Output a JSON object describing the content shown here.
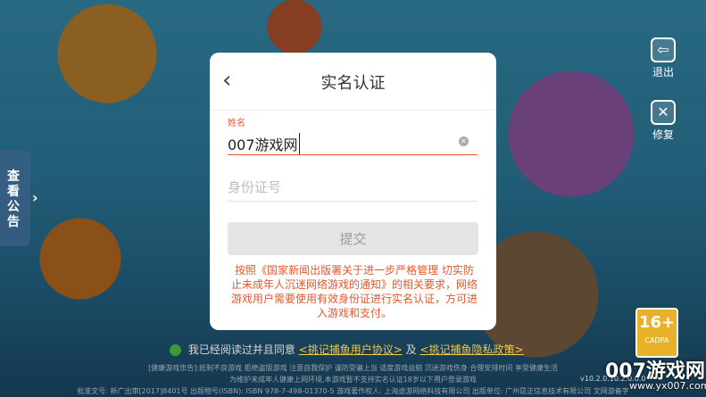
{
  "dialog": {
    "title": "实名认证",
    "name_label": "姓名",
    "name_value": "007游戏网",
    "id_placeholder": "身份证号",
    "submit_label": "提交",
    "notice": "按照《国家新闻出版署关于进一步严格管理 切实防止未成年人沉迷网络游戏的通知》的相关要求，网络游戏用户需要使用有效身份证进行实名认证，方可进入游戏和支付。"
  },
  "side_buttons": {
    "exit": "退出",
    "repair": "修复"
  },
  "notice_tab": "查看公告",
  "rating": {
    "age": "16+",
    "label": "CADPA"
  },
  "agreement": {
    "prefix": "我已经阅读过并且同意",
    "link1": "<挑记捕鱼用户协议>",
    "and": "及",
    "link2": "<挑记捕鱼隐私政策>"
  },
  "footer": {
    "line1": "[健康游戏忠告]:抵制不良游戏 拒绝盗版游戏 注意自我保护 谨防受骗上当 适度游戏益脑 沉迷游戏伤身 合理安排时间 享受健康生活",
    "line2": "为维护未成年人健康上网环境,本游戏暂不支持实名认证18岁以下用户登录游戏",
    "line3": "批准文号: 新广出审[2017]8401号 出版物号(ISBN): ISBN 978-7-498-01370-5 游戏著作权人: 上海途游网络科技有限公司 出版单位: 广州昆正信息技术有限公司 文网游备字",
    "version": "v10.2.0.10.2.0.0.0"
  },
  "watermark": {
    "brand": "007游戏网",
    "url": "www.yx007.com"
  },
  "icons": {
    "back": "chevron-left-icon",
    "clear": "clear-icon",
    "exit": "exit-icon",
    "repair": "wrench-icon"
  },
  "colors": {
    "accent": "#e4572e",
    "submit_bg": "#e5e5e5",
    "link": "#f2c84b"
  }
}
